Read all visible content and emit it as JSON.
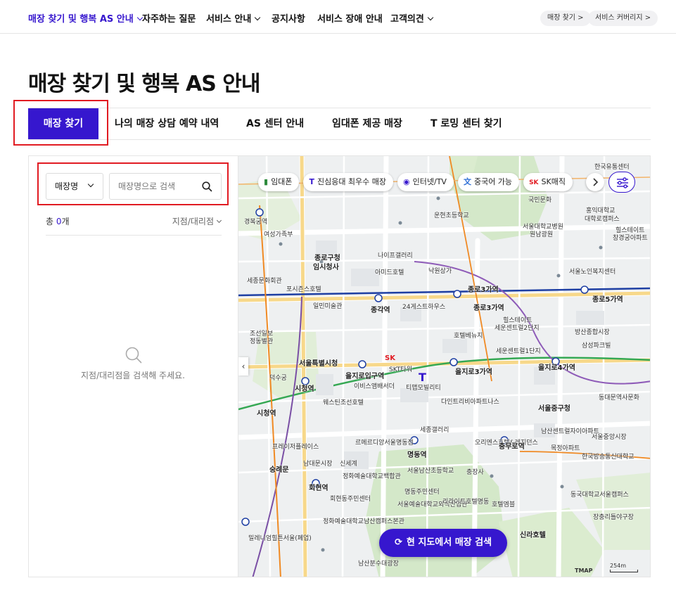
{
  "nav": {
    "items": [
      {
        "label": "매장 찾기 및 행복 AS 안내",
        "active": true,
        "has_chevron": true
      },
      {
        "label": "자주하는 질문",
        "active": false,
        "has_chevron": false
      },
      {
        "label": "서비스 안내",
        "active": false,
        "has_chevron": true
      },
      {
        "label": "공지사항",
        "active": false,
        "has_chevron": false
      },
      {
        "label": "서비스 장애 안내",
        "active": false,
        "has_chevron": false
      },
      {
        "label": "고객의견",
        "active": false,
        "has_chevron": true
      }
    ],
    "pills": [
      {
        "label": "매장 찾기 >"
      },
      {
        "label": "서비스 커버리지 >"
      }
    ]
  },
  "page": {
    "title": "매장 찾기 및 행복 AS 안내"
  },
  "tabs": [
    {
      "label": "매장 찾기",
      "active": true
    },
    {
      "label": "나의 매장 상담 예약 내역",
      "active": false
    },
    {
      "label": "AS 센터 안내",
      "active": false
    },
    {
      "label": "임대폰 제공 매장",
      "active": false
    },
    {
      "label": "T 로밍 센터 찾기",
      "active": false
    }
  ],
  "search": {
    "select_value": "매장명",
    "placeholder": "매장명으로 검색",
    "count_prefix": "총 ",
    "count_value": "0",
    "count_suffix": "개",
    "sort_label": "지점/대리점",
    "empty_message": "지점/대리점을 검색해 주세요."
  },
  "map": {
    "chips": [
      {
        "icon": "▮",
        "label": "임대폰",
        "color": "#2e8b3d"
      },
      {
        "icon": "T",
        "label": "진심응대 최우수 매장",
        "color": "#3617ce"
      },
      {
        "icon": "◉",
        "label": "인터넷/TV",
        "color": "#3617ce"
      },
      {
        "icon": "文",
        "label": "중국어 가능",
        "color": "#2f6fd6"
      },
      {
        "icon": "SK",
        "label": "SK매직",
        "color": "#e11b22"
      }
    ],
    "search_button": "현 지도에서 매장 검색",
    "tmap_label": "TMAP",
    "scale_label": "254m",
    "labels": [
      {
        "text": "한국유통센터"
      },
      {
        "text": "국민문화"
      },
      {
        "text": "홍익대학교"
      },
      {
        "text": "대학로캠퍼스"
      },
      {
        "text": "경복궁역"
      },
      {
        "text": "여성가족부"
      },
      {
        "text": "운현초등학교"
      },
      {
        "text": "서울대학교병원"
      },
      {
        "text": "원남광원"
      },
      {
        "text": "힐스테이트"
      },
      {
        "text": "창경궁아파트"
      },
      {
        "text": "종로구청"
      },
      {
        "text": "임시청사"
      },
      {
        "text": "나이프갤러리"
      },
      {
        "text": "낙원상가"
      },
      {
        "text": "아미드호텔"
      },
      {
        "text": "서울노인복지센터"
      },
      {
        "text": "종로3가역"
      },
      {
        "text": "종로5가역"
      },
      {
        "text": "종로3가역"
      },
      {
        "text": "세종문화회관"
      },
      {
        "text": "포시즌스호텔"
      },
      {
        "text": "일민미술관"
      },
      {
        "text": "종각역"
      },
      {
        "text": "24게스트하우스"
      },
      {
        "text": "힐스테이트"
      },
      {
        "text": "세운센트럴2단지"
      },
      {
        "text": "호텔베뉴지"
      },
      {
        "text": "세운센트럴1단지"
      },
      {
        "text": "방산종합시장"
      },
      {
        "text": "삼성파크빌"
      },
      {
        "text": "조선일보"
      },
      {
        "text": "정동별관"
      },
      {
        "text": "서울특별시청"
      },
      {
        "text": "을지로입구역"
      },
      {
        "text": "SKT타워"
      },
      {
        "text": "을지로3가역"
      },
      {
        "text": "을지로4가역"
      },
      {
        "text": "덕수궁"
      },
      {
        "text": "시청역"
      },
      {
        "text": "이비스앰배서더"
      },
      {
        "text": "티맵모빌리티"
      },
      {
        "text": "다인트리비아파트나스"
      },
      {
        "text": "서울중구청"
      },
      {
        "text": "동대문역사문화"
      },
      {
        "text": "시청역"
      },
      {
        "text": "웨스틴조선호텔"
      },
      {
        "text": "세종갤러리"
      },
      {
        "text": "남산센트럴자이아파트"
      },
      {
        "text": "서울중앙시장"
      },
      {
        "text": "프레이저플레이스"
      },
      {
        "text": "르메르디앙서울명동점"
      },
      {
        "text": "명동역"
      },
      {
        "text": "오리엔스호텔&레지던스"
      },
      {
        "text": "충무로역"
      },
      {
        "text": "목정아파트"
      },
      {
        "text": "숭례문"
      },
      {
        "text": "신세계"
      },
      {
        "text": "남대문시장"
      },
      {
        "text": "서울남산초등학교"
      },
      {
        "text": "충장사"
      },
      {
        "text": "한국방송통신대학교"
      },
      {
        "text": "회현역"
      },
      {
        "text": "정화예술대학교백합관"
      },
      {
        "text": "명동주민센터"
      },
      {
        "text": "회현동주민센터"
      },
      {
        "text": "서울예술대학교외식산업관"
      },
      {
        "text": "리라이트호텔명동"
      },
      {
        "text": "호텔엠블"
      },
      {
        "text": "동국대학교서울캠퍼스"
      },
      {
        "text": "정화예술대학교남산캠퍼스본관"
      },
      {
        "text": "신라호텔"
      },
      {
        "text": "장충리틀야구장"
      },
      {
        "text": "밀레니엄힐튼서울(폐업)"
      },
      {
        "text": "남산분수대광장"
      }
    ]
  }
}
